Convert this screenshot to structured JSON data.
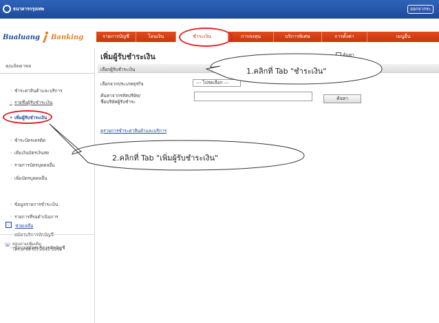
{
  "header": {
    "bank_name": "ธนาคารกรุงเทพ",
    "logout": "ออกจากระ"
  },
  "brand": {
    "part1": "Bualuang",
    "part2": "Banking"
  },
  "nav": {
    "tabs": [
      {
        "label": "รายการบัญชี"
      },
      {
        "label": "โอนเงิน"
      },
      {
        "label": "ชำระเงิน"
      },
      {
        "label": "การลงทุน"
      },
      {
        "label": "บริการพิเศษ"
      },
      {
        "label": "การตั้งค่า"
      },
      {
        "label": "เมนูอื่น"
      }
    ],
    "active_index": 2
  },
  "sidebar": {
    "title": "คุณลัดดาพล",
    "items": [
      {
        "label": "ชำระค่าสินค้าและบริการ"
      },
      {
        "label": "รายชื่อผู้รับชำระเงิน"
      },
      {
        "label": "เพิ่มผู้รับชำระเงิน"
      },
      {
        "label": "ชำระบัตรเครดิต"
      },
      {
        "label": "เติมเงินบัตรเงินสด"
      },
      {
        "label": "รายการบัตรบุคคลอื่น"
      },
      {
        "label": "เพิ่มบัตรบุคคลอื่น"
      },
      {
        "label": "ข้อมูลรายการชำระเงิน"
      },
      {
        "label": "รายการที่รอดำเนินการ"
      },
      {
        "label": "สมัครบริการหักบัญชี"
      },
      {
        "label": "ข้อมูลสมัครบริการหักบัญชี"
      }
    ],
    "help_label": "ช่วยเหลือ",
    "phone_line1": "สอบถามเพิ่มเติม",
    "phone_line2": "โทร. +66 (0) 2645 5555"
  },
  "main": {
    "title": "เพิ่มผู้รับชำระเงิน",
    "search_label": "ค้นหา",
    "section_label": "เลือกผู้รับชำระเงิน",
    "row1_label": "เลือกจากประเภทธุรกิจ",
    "select_value": "--- โปรดเลือก ---",
    "row2_label_line1": "ค้นหาจากรหัสบริษัท/",
    "row2_label_line2": "ชื่อบริษัทผู้รับชำระ",
    "search_button": "ค้นหา",
    "link_all": "ดูรายการชำระค่าสินค้าและบริการ"
  },
  "callouts": {
    "step1": "1.คลิกที่ Tab \"ชำระเงิน\"",
    "step2": "2.คลิกที่ Tab \"เพิ่มผู้รับชำระเงิน\""
  }
}
